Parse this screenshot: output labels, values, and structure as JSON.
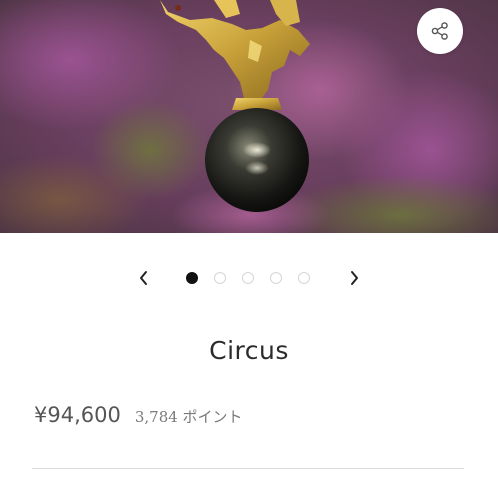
{
  "product": {
    "title": "Circus",
    "price": "¥94,600",
    "points": "3,784 ポイント"
  },
  "carousel": {
    "prev_icon": "chevron-left-icon",
    "next_icon": "chevron-right-icon",
    "prev_glyph": "‹",
    "next_glyph": "›",
    "slide_count": 5,
    "active_index": 0
  },
  "share": {
    "icon": "share-icon"
  },
  "colors": {
    "active_dot": "#111111",
    "inactive_dot_border": "#d6d6d6",
    "title": "#2b2b2b",
    "price": "#555555",
    "points": "#7a7a7a",
    "hero_background": "#6e4a62",
    "pendant_gold": "#c9a13a",
    "pearl": "#1c1d19"
  }
}
